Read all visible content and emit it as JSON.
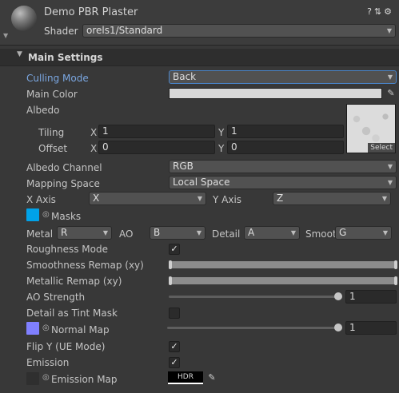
{
  "header": {
    "title": "Demo PBR Plaster",
    "icons": [
      "help-icon",
      "preset-icon",
      "settings-icon"
    ],
    "shader_label": "Shader",
    "shader_value": "orels1/Standard"
  },
  "section": {
    "title": "Main Settings"
  },
  "fields": {
    "culling_mode": {
      "label": "Culling Mode",
      "value": "Back"
    },
    "main_color": {
      "label": "Main Color",
      "color": "#d8d8d8"
    },
    "albedo": {
      "label": "Albedo",
      "select_label": "Select"
    },
    "tiling": {
      "label": "Tiling",
      "x_label": "X",
      "x": "1",
      "y_label": "Y",
      "y": "1"
    },
    "offset": {
      "label": "Offset",
      "x_label": "X",
      "x": "0",
      "y_label": "Y",
      "y": "0"
    },
    "albedo_channel": {
      "label": "Albedo Channel",
      "value": "RGB"
    },
    "mapping_space": {
      "label": "Mapping Space",
      "value": "Local Space"
    },
    "x_axis": {
      "label": "X Axis",
      "value": "X"
    },
    "y_axis": {
      "label": "Y Axis",
      "value": "Z"
    },
    "masks": {
      "label": "Masks",
      "swatch_color": "#00a2e8"
    },
    "metal": {
      "label": "Metal",
      "value": "R"
    },
    "ao": {
      "label": "AO",
      "value": "B"
    },
    "detail": {
      "label": "Detail",
      "value": "A"
    },
    "smooth": {
      "label": "Smoot",
      "value": "G"
    },
    "roughness_mode": {
      "label": "Roughness Mode",
      "checked": "✓"
    },
    "smoothness_remap": {
      "label": "Smoothness Remap (xy)"
    },
    "metallic_remap": {
      "label": "Metallic Remap (xy)"
    },
    "ao_strength": {
      "label": "AO Strength",
      "value": "1",
      "level": 1
    },
    "detail_tint": {
      "label": "Detail as Tint Mask",
      "checked": ""
    },
    "normal_map": {
      "label": "Normal Map",
      "value": "1",
      "level": 1,
      "swatch_color": "#8080ff"
    },
    "flip_y": {
      "label": "Flip Y (UE Mode)",
      "checked": "✓"
    },
    "emission": {
      "label": "Emission",
      "checked": "✓"
    },
    "emission_map": {
      "label": "Emission Map",
      "hdr_label": "HDR"
    }
  },
  "colors": {
    "accent": "#7aa6e0",
    "background": "#383838"
  }
}
